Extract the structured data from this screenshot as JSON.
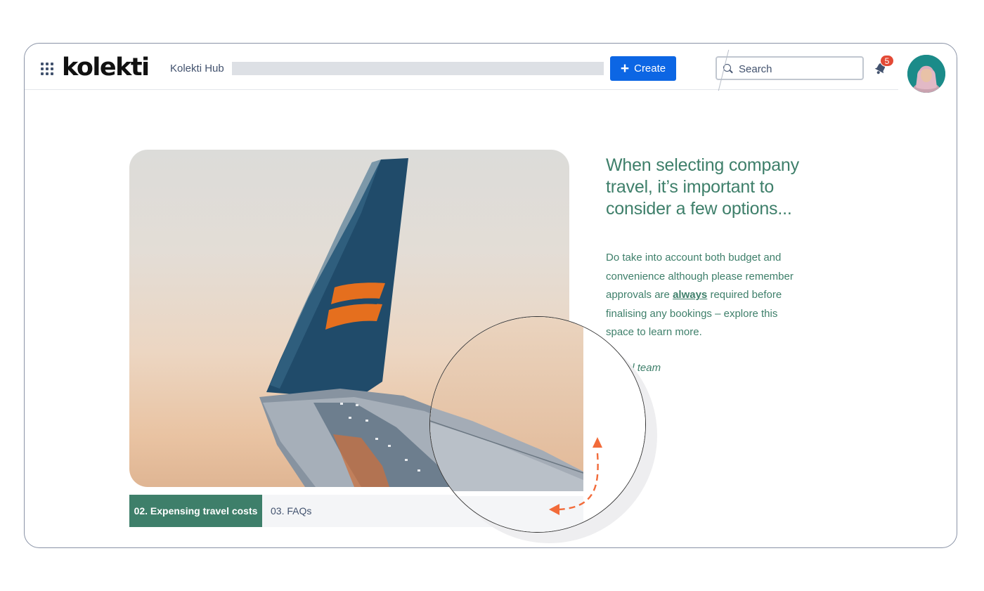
{
  "topbar": {
    "logo_text": "kolekti",
    "hub_label": "Kolekti Hub",
    "create_label": "Create",
    "search_placeholder": "Search",
    "notification_count": "5"
  },
  "hero": {
    "heading": "When selecting company travel, it’s important to consider a few options...",
    "body_before": "Do take into account both budget and convenience although please remember approvals are ",
    "body_emphasis": "always",
    "body_after": " required before finalising any bookings – explore this space to learn more.",
    "signoff": "Travel team"
  },
  "tabs": [
    {
      "label": "02. Expensing travel costs",
      "active": true
    },
    {
      "label": "03. FAQs",
      "active": false
    }
  ],
  "colors": {
    "accent": "#3e7f6a",
    "primary_button": "#0c66e4",
    "annotation_arrow": "#f26b3a",
    "badge": "#e34935"
  },
  "icons": [
    "app-grid-icon",
    "search-icon",
    "bell-icon",
    "plus-icon",
    "avatar"
  ]
}
